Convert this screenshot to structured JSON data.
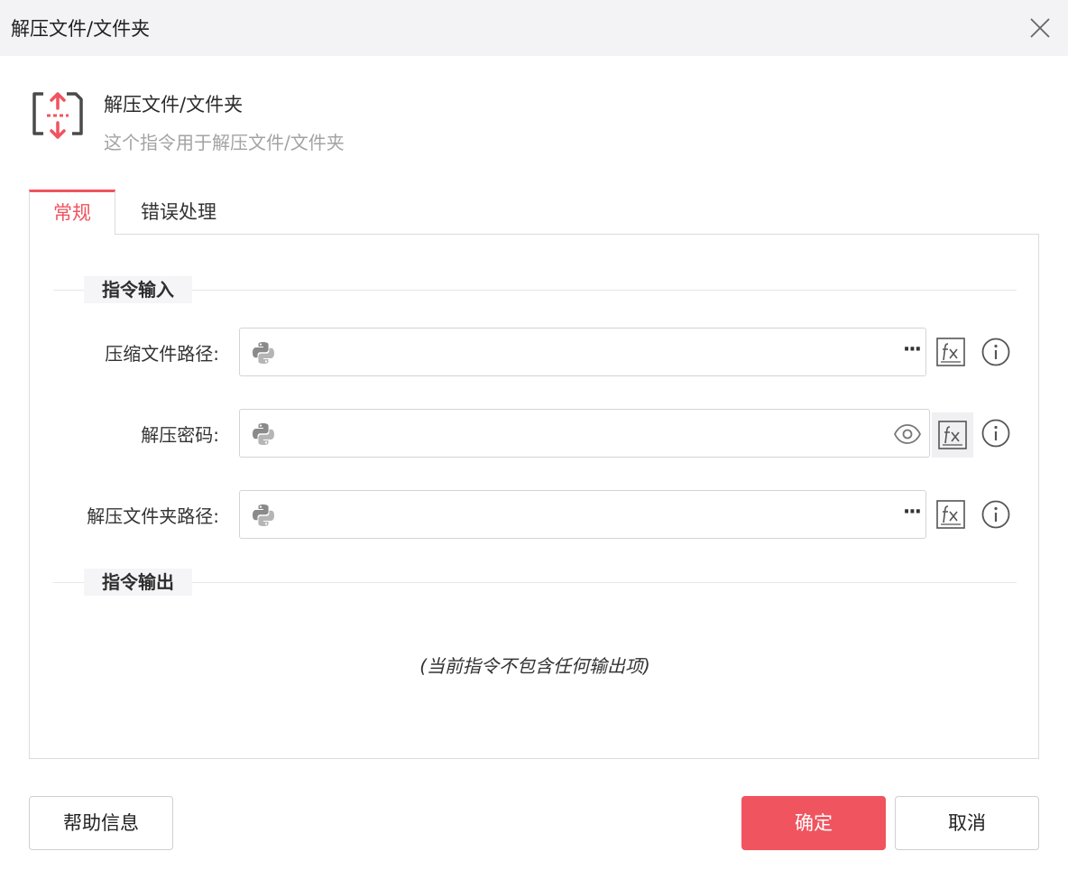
{
  "window": {
    "title": "解压文件/文件夹"
  },
  "command": {
    "name": "解压文件/文件夹",
    "description": "这个指令用于解压文件/文件夹"
  },
  "tabs": [
    {
      "label": "常规",
      "active": true
    },
    {
      "label": "错误处理",
      "active": false
    }
  ],
  "input_section": {
    "label": "指令输入"
  },
  "fields": [
    {
      "label": "压缩文件路径:",
      "value": "",
      "action": "more"
    },
    {
      "label": "解压密码:",
      "value": "",
      "action": "show-password"
    },
    {
      "label": "解压文件夹路径:",
      "value": "",
      "action": "more"
    }
  ],
  "output_section": {
    "label": "指令输出",
    "empty_text": "(当前指令不包含任何输出项)"
  },
  "buttons": {
    "help": "帮助信息",
    "ok": "确定",
    "cancel": "取消"
  },
  "field_more_label": "···",
  "colors": {
    "accent": "#f0545f",
    "border": "#dcdcdc"
  }
}
